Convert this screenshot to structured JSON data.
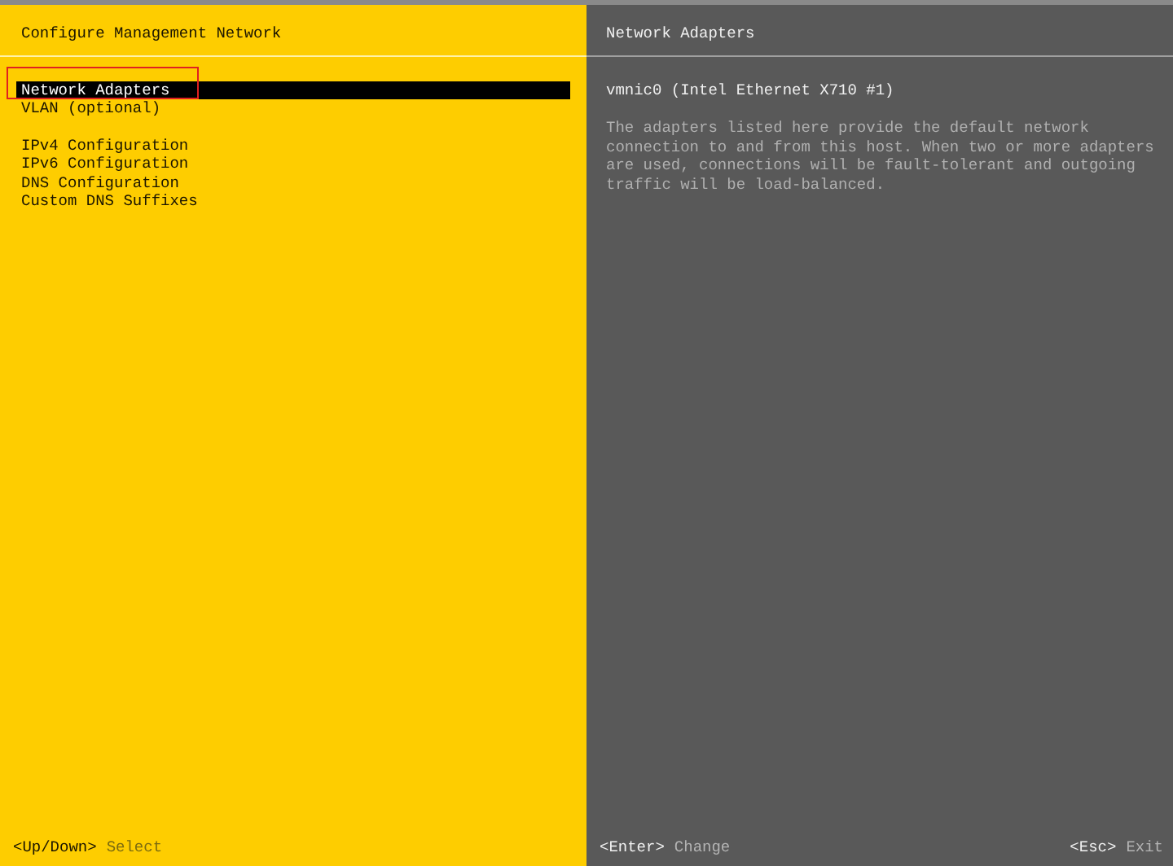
{
  "left_panel": {
    "title": "Configure Management Network",
    "menu_groups": [
      [
        {
          "label": "Network Adapters",
          "selected": true
        },
        {
          "label": "VLAN (optional)",
          "selected": false
        }
      ],
      [
        {
          "label": "IPv4 Configuration",
          "selected": false
        },
        {
          "label": "IPv6 Configuration",
          "selected": false
        },
        {
          "label": "DNS Configuration",
          "selected": false
        },
        {
          "label": "Custom DNS Suffixes",
          "selected": false
        }
      ]
    ],
    "footer": [
      {
        "key": "<Up/Down>",
        "action": "Select"
      }
    ]
  },
  "right_panel": {
    "title": "Network Adapters",
    "adapter": "vmnic0 (Intel Ethernet X710 #1)",
    "description": "The adapters listed here provide the default network connection to and from this host. When two or more adapters are used, connections will be fault-tolerant and outgoing traffic will be load-balanced.",
    "footer": [
      {
        "key": "<Enter>",
        "action": "Change"
      },
      {
        "key": "<Esc>",
        "action": "Exit"
      }
    ]
  }
}
